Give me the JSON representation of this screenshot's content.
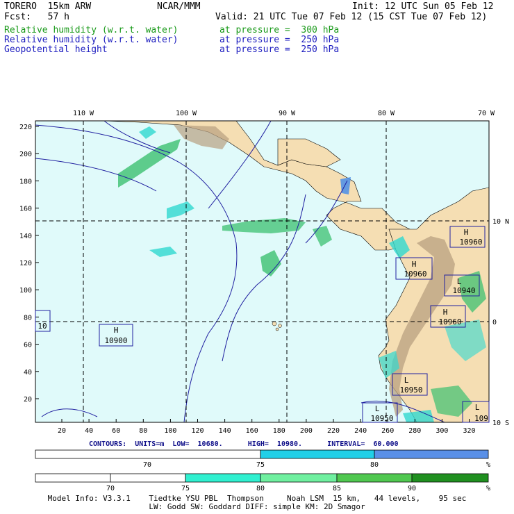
{
  "header": {
    "model": "TORERO  15km ARW",
    "org": "NCAR/MMM",
    "init": "Init: 12 UTC Sun 05 Feb 12",
    "fcst": "Fcst:   57 h",
    "valid": "Valid: 21 UTC Tue 07 Feb 12 (15 CST Tue 07 Feb 12)",
    "fields": [
      {
        "name": "Relative humidity (w.r.t. water)",
        "level": "at pressure =  300 hPa",
        "color": "#1a9a1a"
      },
      {
        "name": "Relative humidity (w.r.t. water)",
        "level": "at pressure =  250 hPa",
        "color": "#2020c0"
      },
      {
        "name": "Geopotential height",
        "level": "at pressure =  250 hPa",
        "color": "#2020c0"
      }
    ]
  },
  "map": {
    "left_ticks": [
      "220",
      "200",
      "180",
      "160",
      "140",
      "120",
      "100",
      "80",
      "60",
      "40",
      "20"
    ],
    "bottom_ticks": [
      "20",
      "40",
      "60",
      "80",
      "100",
      "120",
      "140",
      "160",
      "180",
      "200",
      "220",
      "240",
      "260",
      "280",
      "300",
      "320"
    ],
    "top_lon_labels": [
      "110 W",
      "100 W",
      "90 W",
      "80 W",
      "70 W"
    ],
    "right_lat_labels": [
      "10 N",
      "0",
      "10 S"
    ],
    "centers": [
      {
        "type": "H",
        "value": "10900"
      },
      {
        "type": "H",
        "value": "10960"
      },
      {
        "type": "H",
        "value": "10960"
      },
      {
        "type": "L",
        "value": "10940"
      },
      {
        "type": "H",
        "value": "10960"
      },
      {
        "type": "L",
        "value": "10950"
      },
      {
        "type": "L",
        "value": "10950"
      },
      {
        "type": "L",
        "value": "109"
      },
      {
        "type": "",
        "value": "10"
      }
    ],
    "colors": {
      "ocean": "#e0fafa",
      "land": "#f5deb3",
      "mountain": "#b8a080",
      "rh_blue": "#4a8ee8",
      "rh_green": "#3cc070",
      "rh_cyan": "#30d8d0"
    }
  },
  "contours": "CONTOURS:  UNITS=m  LOW=  10680.      HIGH=  10980.      INTERVAL=  60.000",
  "colorbar1": {
    "labels": [
      "70",
      "75",
      "80"
    ],
    "unit": "%",
    "colors": [
      "#ffffff",
      "#20d0e8",
      "#5a90e8"
    ]
  },
  "colorbar2": {
    "labels": [
      "70",
      "75",
      "80",
      "85",
      "90"
    ],
    "unit": "%",
    "colors": [
      "#ffffff",
      "#ffffff",
      "#30f0d0",
      "#70f0a0",
      "#50c850",
      "#209020"
    ]
  },
  "footer": {
    "line1": "Model Info: V3.3.1    Tiedtke YSU PBL  Thompson     Noah LSM  15 km,   44 levels,    95 sec",
    "line2": "LW: Godd SW: Goddard DIFF: simple KM: 2D Smagor"
  }
}
